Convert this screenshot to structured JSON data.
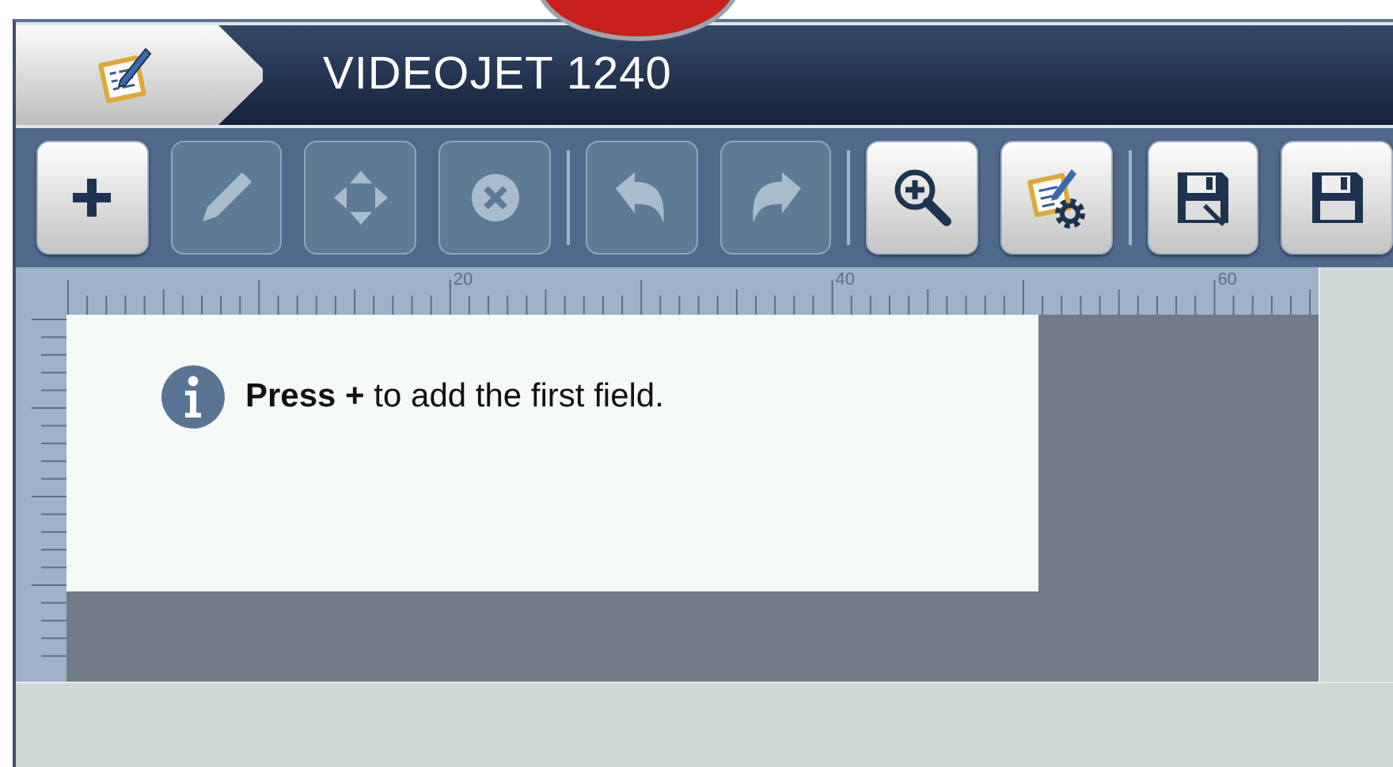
{
  "header": {
    "title": "VIDEOJET 1240"
  },
  "toolbar": {
    "groups": [
      [
        {
          "kind": "add",
          "disabled": false
        },
        {
          "kind": "edit",
          "disabled": true
        },
        {
          "kind": "move",
          "disabled": true
        },
        {
          "kind": "delete",
          "disabled": true
        }
      ],
      [
        {
          "kind": "undo",
          "disabled": true
        },
        {
          "kind": "redo",
          "disabled": true
        }
      ],
      [
        {
          "kind": "zoom",
          "disabled": false
        },
        {
          "kind": "settings",
          "disabled": false
        }
      ],
      [
        {
          "kind": "save_as",
          "disabled": false
        },
        {
          "kind": "save",
          "disabled": false
        }
      ]
    ]
  },
  "ruler": {
    "labels": [
      "20",
      "40",
      "60"
    ]
  },
  "canvas": {
    "message": "**Press +** to add the first field."
  }
}
